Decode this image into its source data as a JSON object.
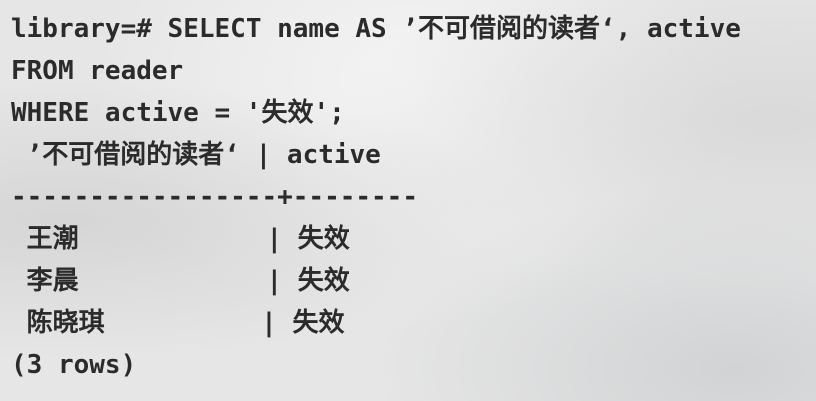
{
  "terminal": {
    "prompt": "library=# ",
    "query_lines": [
      "SELECT name AS ’不可借阅的读者‘, active",
      "FROM reader",
      "WHERE active = '失效';"
    ],
    "result": {
      "header": " ’不可借阅的读者‘ | active",
      "separator": "-----------------+--------",
      "rows": [
        " 王潮            | 失效",
        " 李晨            | 失效",
        " 陈晓琪          | 失效"
      ],
      "footer": "(3 rows)"
    }
  }
}
